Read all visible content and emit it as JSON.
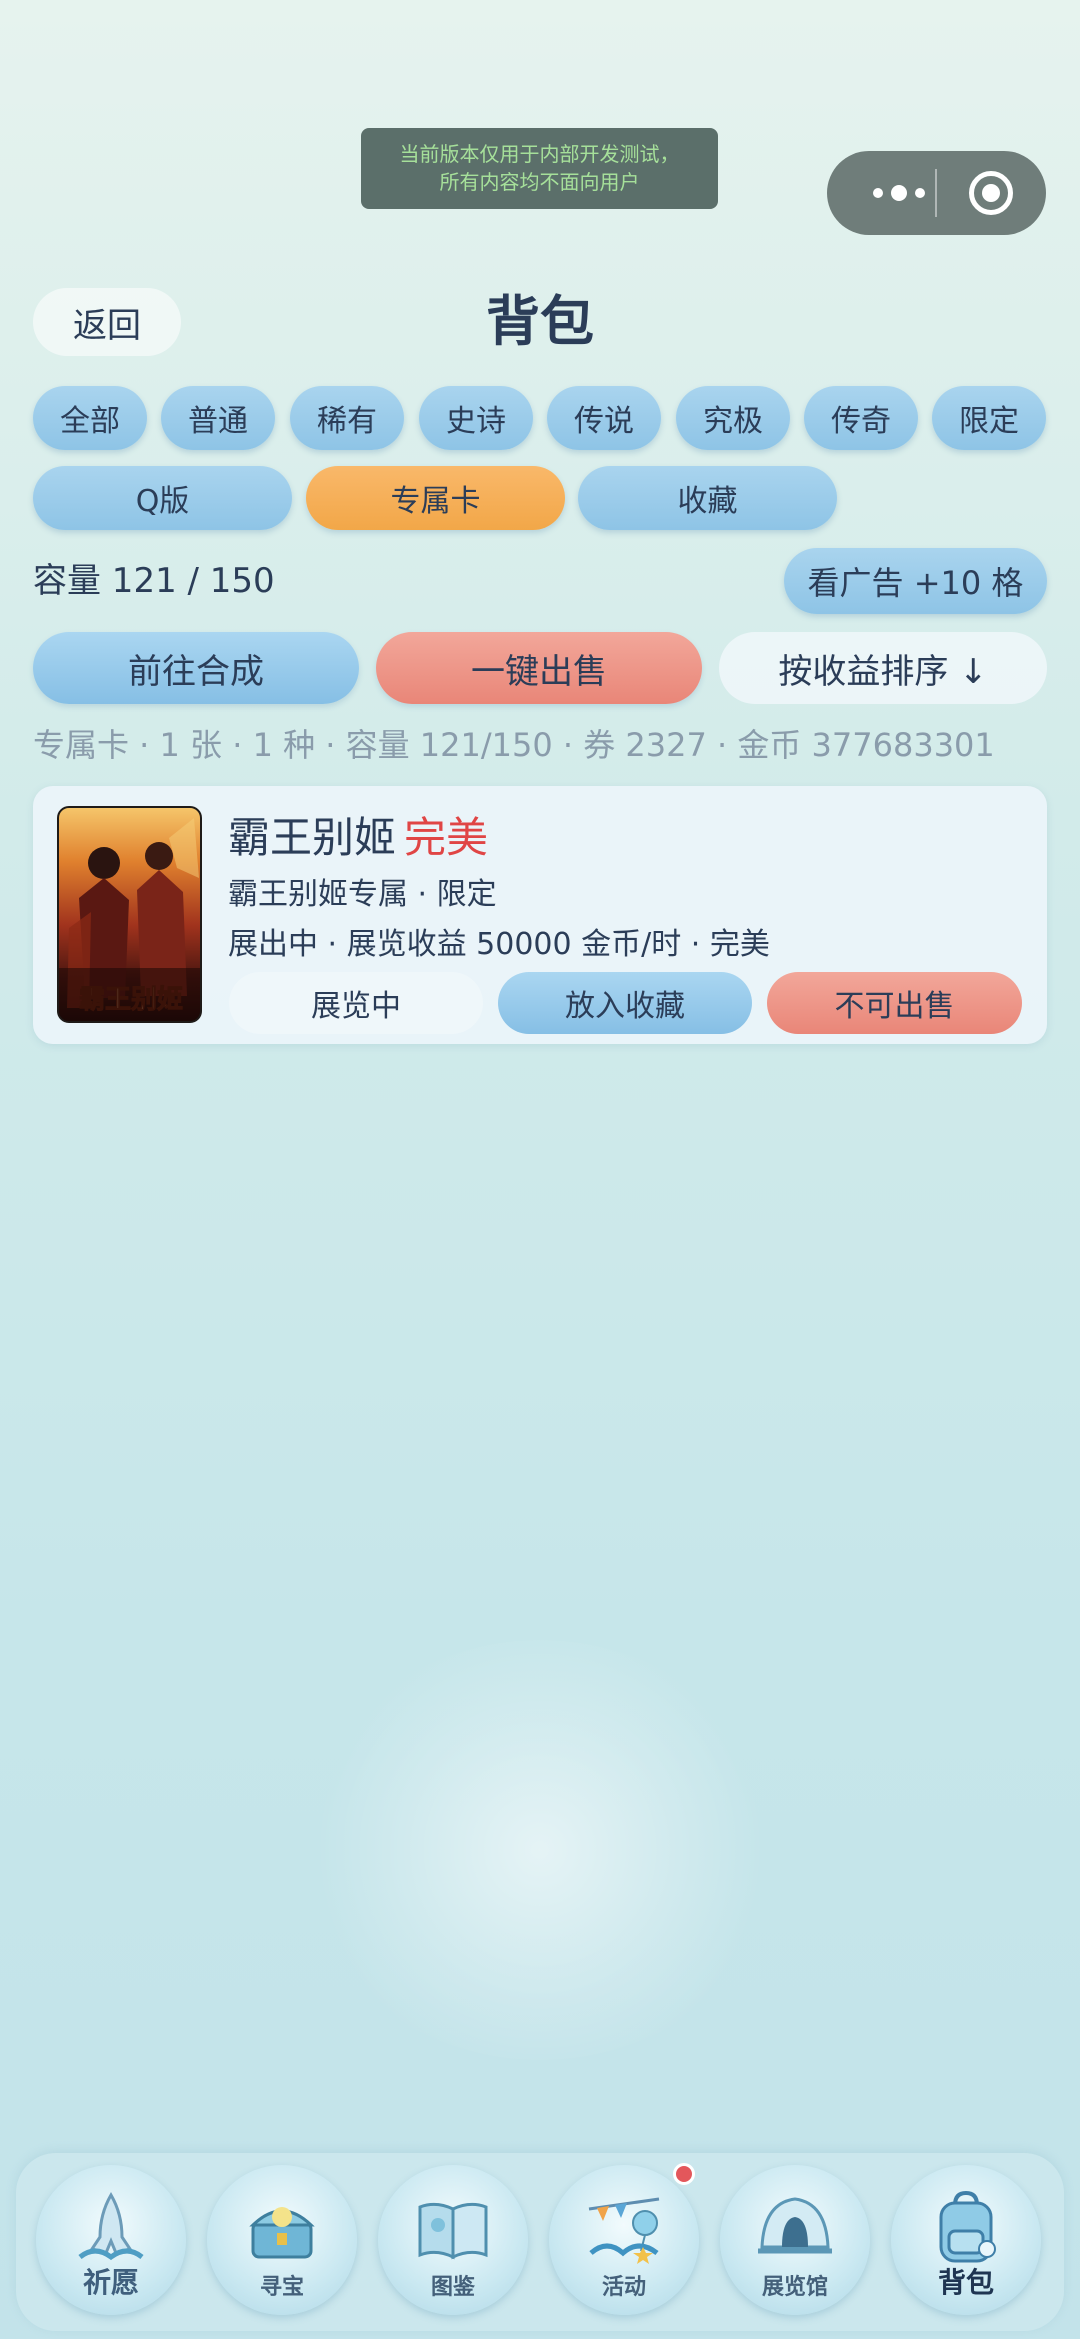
{
  "dev_notice": {
    "line1": "当前版本仅用于内部开发测试，",
    "line2": "所有内容均不面向用户"
  },
  "header": {
    "back_label": "返回",
    "title": "背包"
  },
  "filters": {
    "row1": [
      "全部",
      "普通",
      "稀有",
      "史诗",
      "传说",
      "究极",
      "传奇",
      "限定"
    ],
    "row2": [
      "Q版",
      "专属卡",
      "收藏"
    ],
    "active": "专属卡"
  },
  "capacity": {
    "label": "容量 121 / 150",
    "ad_button": "看广告 +10 格"
  },
  "actions": {
    "synthesize": "前往合成",
    "sell_all": "一键出售",
    "sort": "按收益排序 ↓"
  },
  "summary": "专属卡 · 1 张 · 1 种 · 容量 121/150 · 券 2327 · 金币 377683301",
  "cards": [
    {
      "name": "霸王别姬",
      "quality": "完美",
      "subtitle": "霸王别姬专属 · 限定",
      "info": "展出中 · 展览收益 50000 金币/时 · 完美",
      "image_caption": "霸王别姬",
      "buttons": {
        "status": "展览中",
        "collect": "放入收藏",
        "sell": "不可出售"
      }
    }
  ],
  "tabbar": {
    "items": [
      {
        "label": "祈愿",
        "icon": "praying-hands-icon"
      },
      {
        "label": "寻宝",
        "icon": "treasure-chest-icon"
      },
      {
        "label": "图鉴",
        "icon": "open-book-icon"
      },
      {
        "label": "活动",
        "icon": "balloons-icon",
        "badge": true
      },
      {
        "label": "展览馆",
        "icon": "shell-hall-icon"
      },
      {
        "label": "背包",
        "icon": "backpack-icon",
        "active": true
      }
    ]
  }
}
